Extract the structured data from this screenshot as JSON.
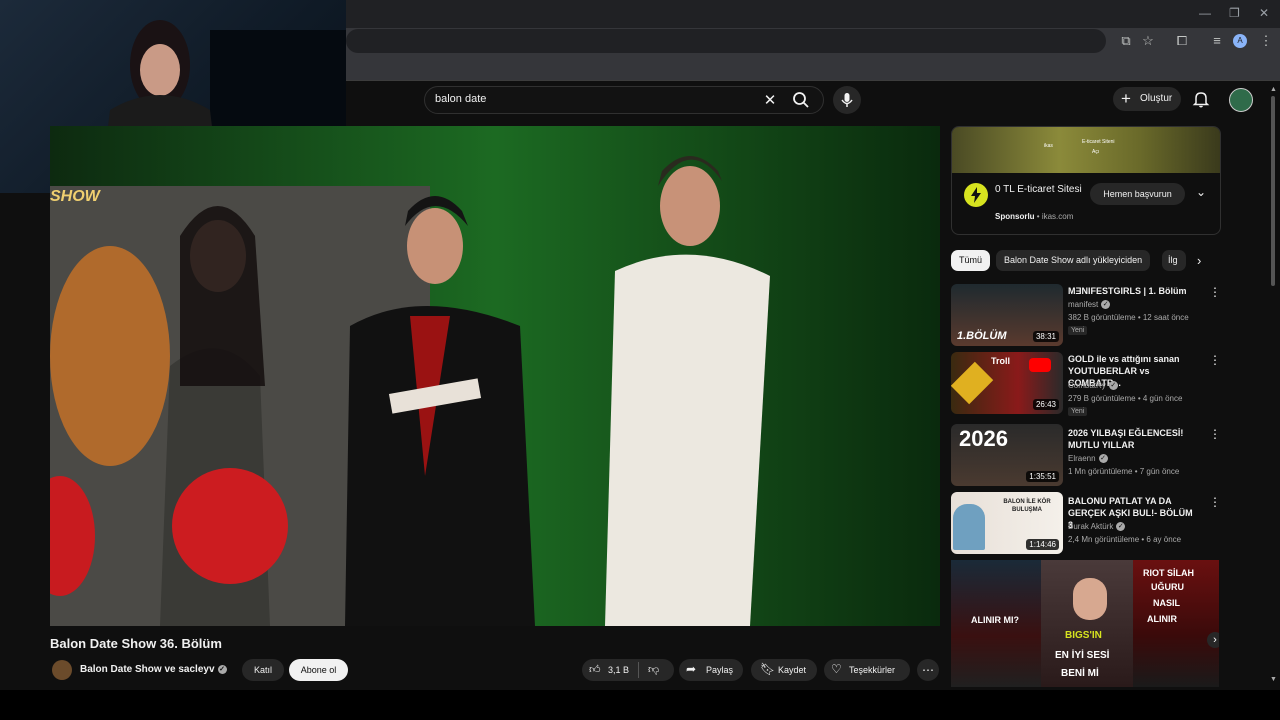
{
  "search": {
    "query": "balon date"
  },
  "header": {
    "create_label": "Oluştur"
  },
  "video": {
    "title": "Balon Date Show 36. Bölüm",
    "overlay_text": "SHOW",
    "channel": "Balon Date Show ve sacleyv",
    "join_label": "Katıl",
    "subscribe_label": "Abone ol",
    "like_count": "3,1 B",
    "share_label": "Paylaş",
    "save_label": "Kaydet",
    "thanks_label": "Teşekkürler"
  },
  "ad": {
    "image_text_1": "ikas",
    "image_text_2": "E-ticaret Siteni",
    "image_text_3": "Açı",
    "title": "0 TL E-ticaret Sitesi",
    "sponsored": "Sponsorlu",
    "domain": "ikas.com",
    "button": "Hemen başvurun"
  },
  "chips": [
    "Tümü",
    "Balon Date Show adlı yükleyiciden",
    "İlg"
  ],
  "recommendations": [
    {
      "title": "MƎNIFESTGIRLS | 1. Bölüm",
      "channel": "manifest",
      "meta": "382 B görüntüleme • 12 saat önce",
      "badge": "Yeni",
      "duration": "38:31",
      "thumb_text": "1.BÖLÜM"
    },
    {
      "title": "GOLD ile vs attığını sanan YOUTUBERLAR vs COMBATR...",
      "channel": "CombatRy",
      "meta": "279 B görüntüleme • 4 gün önce",
      "badge": "Yeni",
      "duration": "26:43",
      "thumb_text": "Troll"
    },
    {
      "title": "2026 YILBAŞI EĞLENCESİ! MUTLU YILLAR",
      "channel": "Elraenn",
      "meta": "1 Mn görüntüleme • 7 gün önce",
      "badge": "",
      "duration": "1:35:51",
      "thumb_text": "2026"
    },
    {
      "title": "BALONU PATLAT YA DA GERÇEK AŞKI BUL!- BÖLÜM 3",
      "channel": "Burak Aktürk",
      "meta": "2,4 Mn görüntüleme • 6 ay önce",
      "badge": "",
      "duration": "1:14:46",
      "thumb_text": "BALON İLE KÖR BULUŞMA"
    }
  ],
  "promo": {
    "t1": "ALINIR MI?",
    "t2": "BIGS'IN",
    "t3": "EN İYİ SESİ",
    "t4": "BENİ Mİ",
    "t5": "RIOT SİLAH",
    "t6": "UĞURU",
    "t7": "NASIL",
    "t8": "ALINIR"
  },
  "colors": {
    "background": "#0f0f0f",
    "chip_active": "#f1f1f1",
    "accent_red": "#ff0000"
  }
}
